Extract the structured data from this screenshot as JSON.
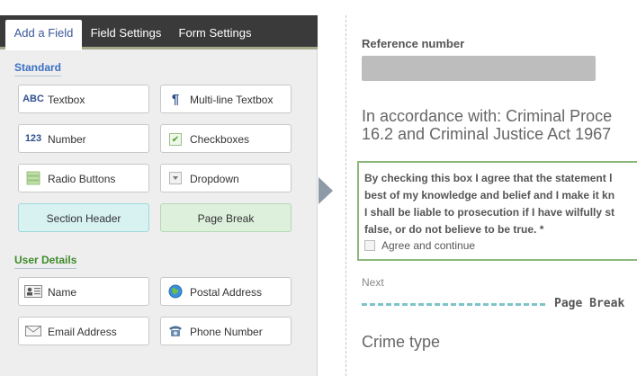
{
  "tabs": [
    {
      "label": "Add a Field"
    },
    {
      "label": "Field Settings"
    },
    {
      "label": "Form Settings"
    }
  ],
  "sections": {
    "standard": {
      "title": "Standard",
      "color": "#3a6fc4",
      "buttons": [
        {
          "label": "Textbox",
          "icon": "ABC"
        },
        {
          "label": "Multi-line Textbox",
          "icon": "¶"
        },
        {
          "label": "Number",
          "icon": "123"
        },
        {
          "label": "Checkboxes",
          "icon": "✔"
        },
        {
          "label": "Radio Buttons",
          "icon": "radio-list-icon"
        },
        {
          "label": "Dropdown",
          "icon": "dropdown-icon"
        },
        {
          "label": "Section Header"
        },
        {
          "label": "Page Break"
        }
      ]
    },
    "user_details": {
      "title": "User Details",
      "color": "#3c8a2a",
      "buttons": [
        {
          "label": "Name",
          "icon": "id-card-icon"
        },
        {
          "label": "Postal Address",
          "icon": "globe-icon"
        },
        {
          "label": "Email Address",
          "icon": "envelope-icon"
        },
        {
          "label": "Phone Number",
          "icon": "phone-icon"
        }
      ]
    }
  },
  "preview": {
    "reference_label": "Reference number",
    "statement_line1": "In accordance with: Criminal Proce",
    "statement_line2": "16.2 and Criminal Justice Act 1967",
    "agree_text_lines": [
      "By checking this box I agree that the statement l",
      "best of my knowledge and belief and I make it kn",
      "I shall be liable to prosecution if I have wilfully st",
      "false, or do not believe to be true. *"
    ],
    "agree_checkbox_label": "Agree and continue",
    "next_label": "Next",
    "page_break_label": "Page Break",
    "crime_type_label": "Crime type"
  }
}
